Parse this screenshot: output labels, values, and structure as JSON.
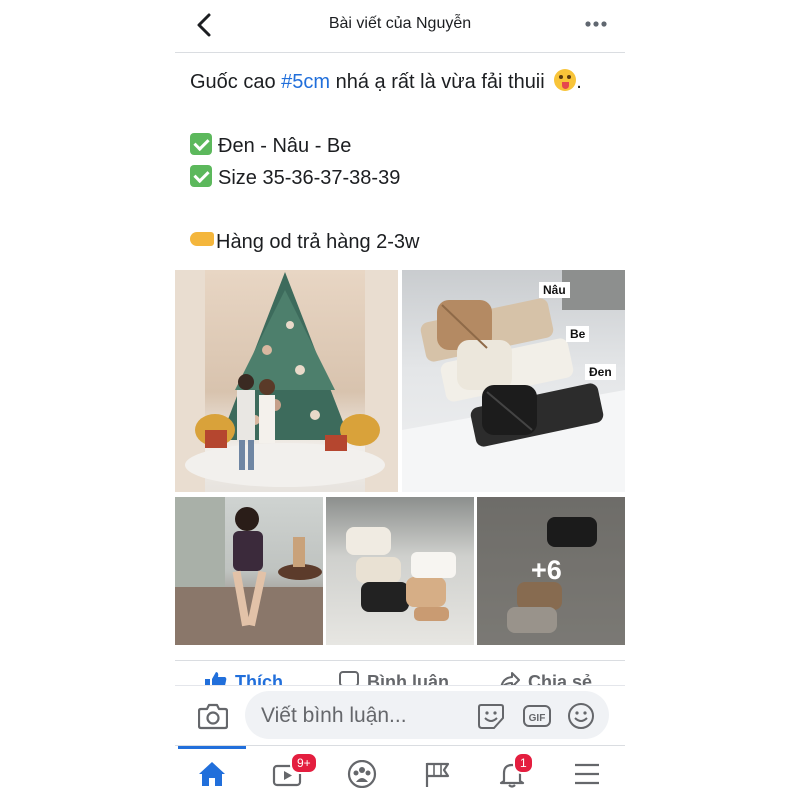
{
  "header": {
    "title": "Bài viết của Nguyễn"
  },
  "post": {
    "line1_before": "Guốc cao ",
    "line1_hashtag": "#5cm",
    "line1_after": " nhá ạ rất là vừa fải thuii",
    "line2": "Đen - Nâu - Be",
    "line3": "Size 35-36-37-38-39",
    "line4": "Hàng od trả hàng 2-3w"
  },
  "photos": {
    "shoe_labels": [
      "Nâu",
      "Be",
      "Đen"
    ],
    "more_count": "+6"
  },
  "actions": {
    "like": "Thích",
    "comment": "Bình luận",
    "share": "Chia sẻ"
  },
  "composer": {
    "placeholder": "Viết bình luận..."
  },
  "bottom_nav": {
    "watch_badge": "9+",
    "notifications_badge": "1"
  },
  "colors": {
    "accent": "#216fdb",
    "badge": "#e41e3f"
  }
}
